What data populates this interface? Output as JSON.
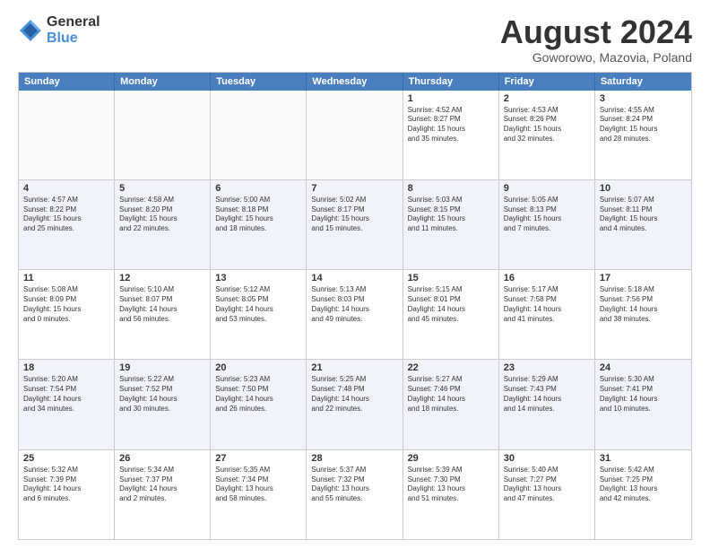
{
  "logo": {
    "general": "General",
    "blue": "Blue"
  },
  "title": "August 2024",
  "subtitle": "Goworowo, Mazovia, Poland",
  "header_days": [
    "Sunday",
    "Monday",
    "Tuesday",
    "Wednesday",
    "Thursday",
    "Friday",
    "Saturday"
  ],
  "rows": [
    [
      {
        "day": "",
        "info": "",
        "empty": true
      },
      {
        "day": "",
        "info": "",
        "empty": true
      },
      {
        "day": "",
        "info": "",
        "empty": true
      },
      {
        "day": "",
        "info": "",
        "empty": true
      },
      {
        "day": "1",
        "info": "Sunrise: 4:52 AM\nSunset: 8:27 PM\nDaylight: 15 hours\nand 35 minutes."
      },
      {
        "day": "2",
        "info": "Sunrise: 4:53 AM\nSunset: 8:26 PM\nDaylight: 15 hours\nand 32 minutes."
      },
      {
        "day": "3",
        "info": "Sunrise: 4:55 AM\nSunset: 8:24 PM\nDaylight: 15 hours\nand 28 minutes."
      }
    ],
    [
      {
        "day": "4",
        "info": "Sunrise: 4:57 AM\nSunset: 8:22 PM\nDaylight: 15 hours\nand 25 minutes."
      },
      {
        "day": "5",
        "info": "Sunrise: 4:58 AM\nSunset: 8:20 PM\nDaylight: 15 hours\nand 22 minutes."
      },
      {
        "day": "6",
        "info": "Sunrise: 5:00 AM\nSunset: 8:18 PM\nDaylight: 15 hours\nand 18 minutes."
      },
      {
        "day": "7",
        "info": "Sunrise: 5:02 AM\nSunset: 8:17 PM\nDaylight: 15 hours\nand 15 minutes."
      },
      {
        "day": "8",
        "info": "Sunrise: 5:03 AM\nSunset: 8:15 PM\nDaylight: 15 hours\nand 11 minutes."
      },
      {
        "day": "9",
        "info": "Sunrise: 5:05 AM\nSunset: 8:13 PM\nDaylight: 15 hours\nand 7 minutes."
      },
      {
        "day": "10",
        "info": "Sunrise: 5:07 AM\nSunset: 8:11 PM\nDaylight: 15 hours\nand 4 minutes."
      }
    ],
    [
      {
        "day": "11",
        "info": "Sunrise: 5:08 AM\nSunset: 8:09 PM\nDaylight: 15 hours\nand 0 minutes."
      },
      {
        "day": "12",
        "info": "Sunrise: 5:10 AM\nSunset: 8:07 PM\nDaylight: 14 hours\nand 56 minutes."
      },
      {
        "day": "13",
        "info": "Sunrise: 5:12 AM\nSunset: 8:05 PM\nDaylight: 14 hours\nand 53 minutes."
      },
      {
        "day": "14",
        "info": "Sunrise: 5:13 AM\nSunset: 8:03 PM\nDaylight: 14 hours\nand 49 minutes."
      },
      {
        "day": "15",
        "info": "Sunrise: 5:15 AM\nSunset: 8:01 PM\nDaylight: 14 hours\nand 45 minutes."
      },
      {
        "day": "16",
        "info": "Sunrise: 5:17 AM\nSunset: 7:58 PM\nDaylight: 14 hours\nand 41 minutes."
      },
      {
        "day": "17",
        "info": "Sunrise: 5:18 AM\nSunset: 7:56 PM\nDaylight: 14 hours\nand 38 minutes."
      }
    ],
    [
      {
        "day": "18",
        "info": "Sunrise: 5:20 AM\nSunset: 7:54 PM\nDaylight: 14 hours\nand 34 minutes."
      },
      {
        "day": "19",
        "info": "Sunrise: 5:22 AM\nSunset: 7:52 PM\nDaylight: 14 hours\nand 30 minutes."
      },
      {
        "day": "20",
        "info": "Sunrise: 5:23 AM\nSunset: 7:50 PM\nDaylight: 14 hours\nand 26 minutes."
      },
      {
        "day": "21",
        "info": "Sunrise: 5:25 AM\nSunset: 7:48 PM\nDaylight: 14 hours\nand 22 minutes."
      },
      {
        "day": "22",
        "info": "Sunrise: 5:27 AM\nSunset: 7:46 PM\nDaylight: 14 hours\nand 18 minutes."
      },
      {
        "day": "23",
        "info": "Sunrise: 5:29 AM\nSunset: 7:43 PM\nDaylight: 14 hours\nand 14 minutes."
      },
      {
        "day": "24",
        "info": "Sunrise: 5:30 AM\nSunset: 7:41 PM\nDaylight: 14 hours\nand 10 minutes."
      }
    ],
    [
      {
        "day": "25",
        "info": "Sunrise: 5:32 AM\nSunset: 7:39 PM\nDaylight: 14 hours\nand 6 minutes."
      },
      {
        "day": "26",
        "info": "Sunrise: 5:34 AM\nSunset: 7:37 PM\nDaylight: 14 hours\nand 2 minutes."
      },
      {
        "day": "27",
        "info": "Sunrise: 5:35 AM\nSunset: 7:34 PM\nDaylight: 13 hours\nand 58 minutes."
      },
      {
        "day": "28",
        "info": "Sunrise: 5:37 AM\nSunset: 7:32 PM\nDaylight: 13 hours\nand 55 minutes."
      },
      {
        "day": "29",
        "info": "Sunrise: 5:39 AM\nSunset: 7:30 PM\nDaylight: 13 hours\nand 51 minutes."
      },
      {
        "day": "30",
        "info": "Sunrise: 5:40 AM\nSunset: 7:27 PM\nDaylight: 13 hours\nand 47 minutes."
      },
      {
        "day": "31",
        "info": "Sunrise: 5:42 AM\nSunset: 7:25 PM\nDaylight: 13 hours\nand 42 minutes."
      }
    ]
  ]
}
